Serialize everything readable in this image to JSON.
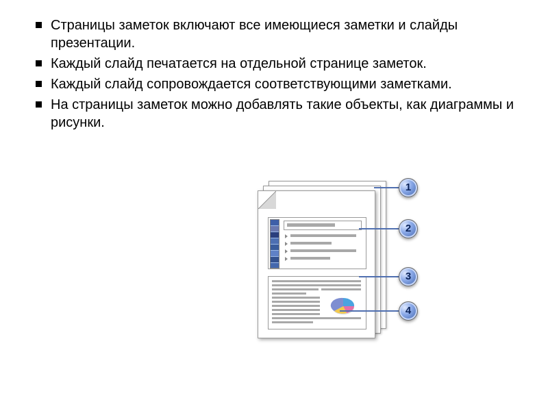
{
  "bullets": [
    " Страницы заметок включают все имеющиеся заметки и слайды презентации.",
    " Каждый слайд печатается на отдельной странице заметок.",
    " Каждый слайд сопровождается соответствующими заметками.",
    " На страницы заметок можно добавлять такие объекты, как диаграммы и рисунки."
  ],
  "callouts": {
    "c1": "1",
    "c2": "2",
    "c3": "3",
    "c4": "4"
  }
}
